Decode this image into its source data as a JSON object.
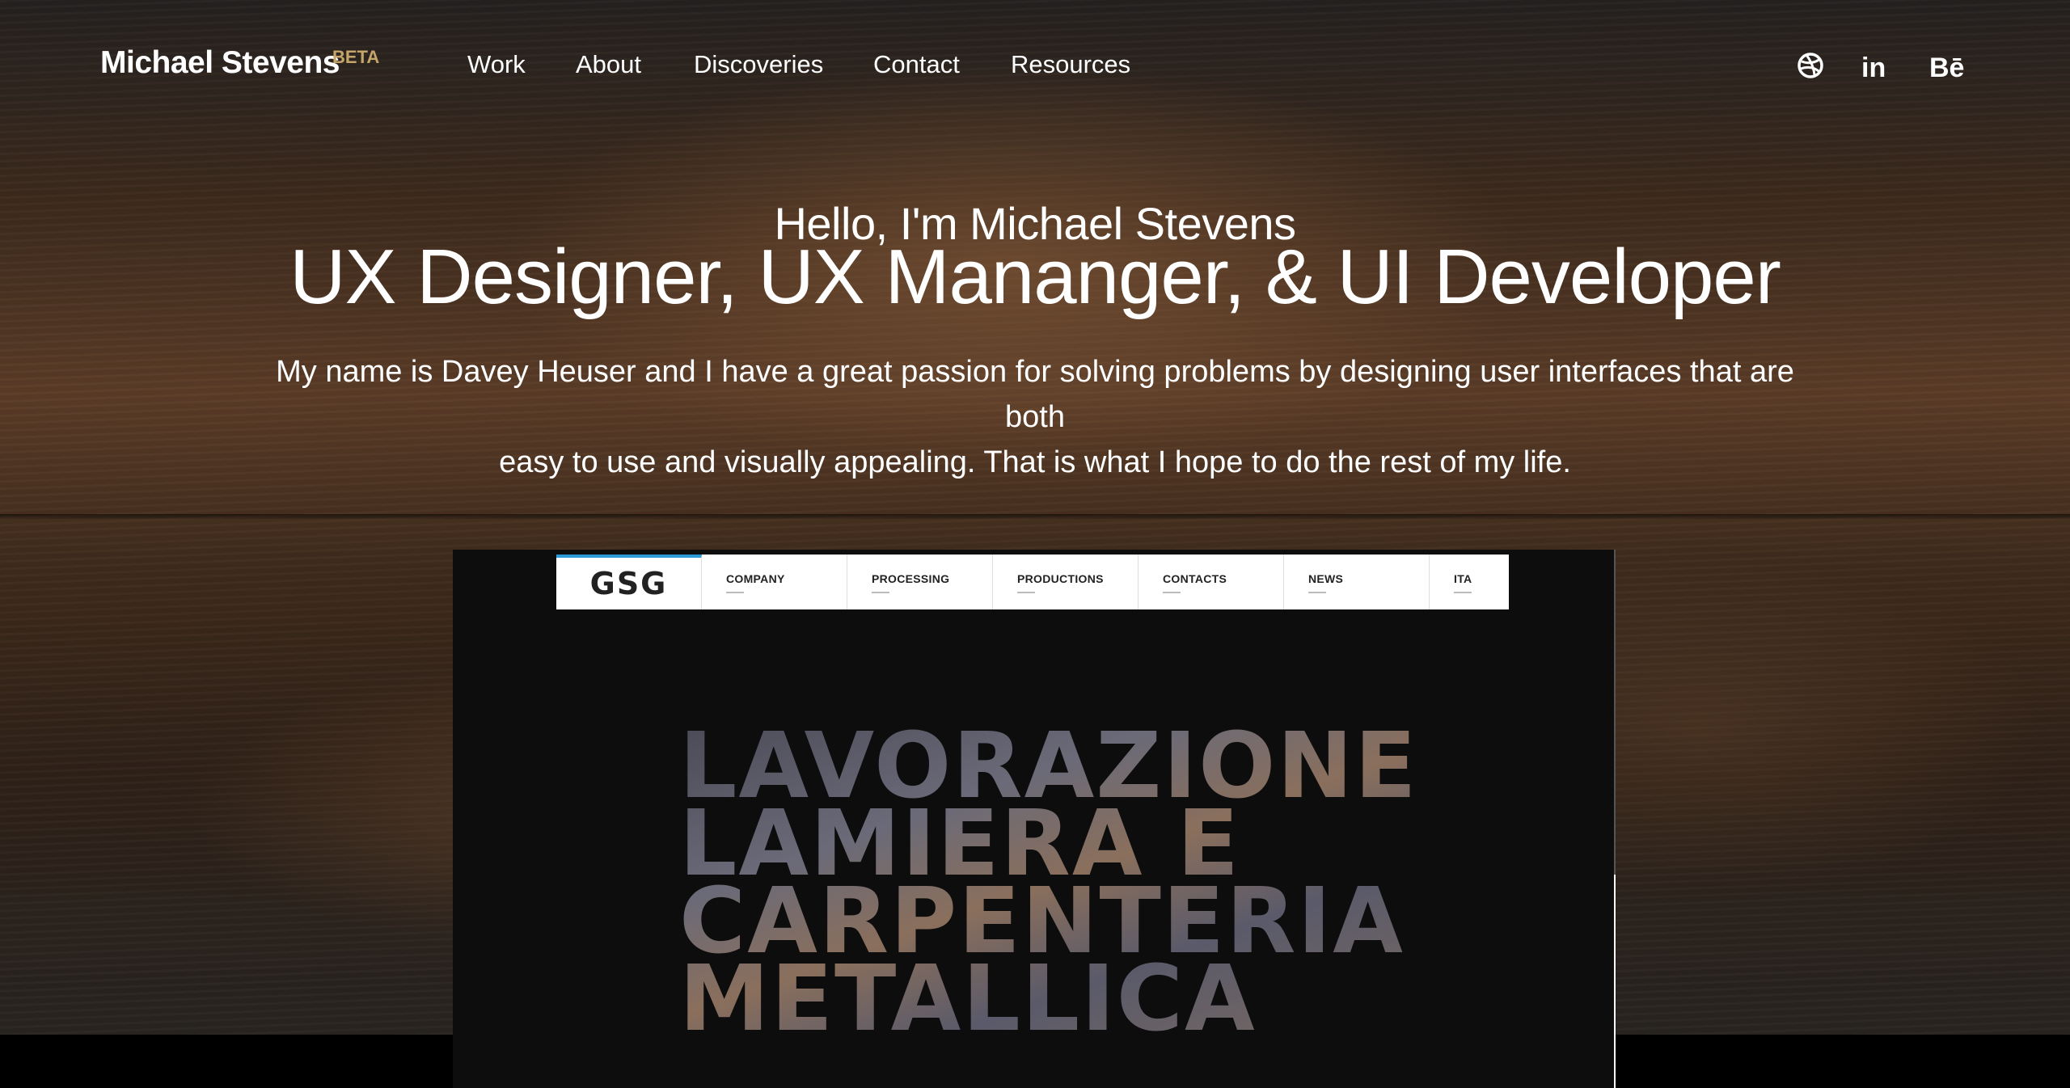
{
  "header": {
    "logo": "Michael Stevens",
    "badge": "BETA",
    "nav": [
      "Work",
      "About",
      "Discoveries",
      "Contact",
      "Resources"
    ],
    "social": [
      {
        "name": "dribbble-icon"
      },
      {
        "name": "linkedin-icon",
        "text": "in"
      },
      {
        "name": "behance-icon",
        "text": "Bē"
      }
    ]
  },
  "hero": {
    "greeting": "Hello, I'm Michael Stevens",
    "tagline": "UX Designer, UX Mananger, & UI Developer",
    "intro_line1": "My name is Davey Heuser and I have a great passion for solving problems by designing user interfaces that are both",
    "intro_line2": "easy to use and visually appealing. That is what I hope to do the rest of my life."
  },
  "showcase": {
    "site_logo": "GSG",
    "site_nav": [
      "COMPANY",
      "PROCESSING",
      "PRODUCTIONS",
      "CONTACTS",
      "NEWS",
      "ITA"
    ],
    "headline": [
      "LAVORAZIONE",
      "LAMIERA E",
      "CARPENTERIA",
      "METALLICA"
    ]
  },
  "colors": {
    "badge": "#c4a56a",
    "site_accent": "#2b9ad6"
  }
}
